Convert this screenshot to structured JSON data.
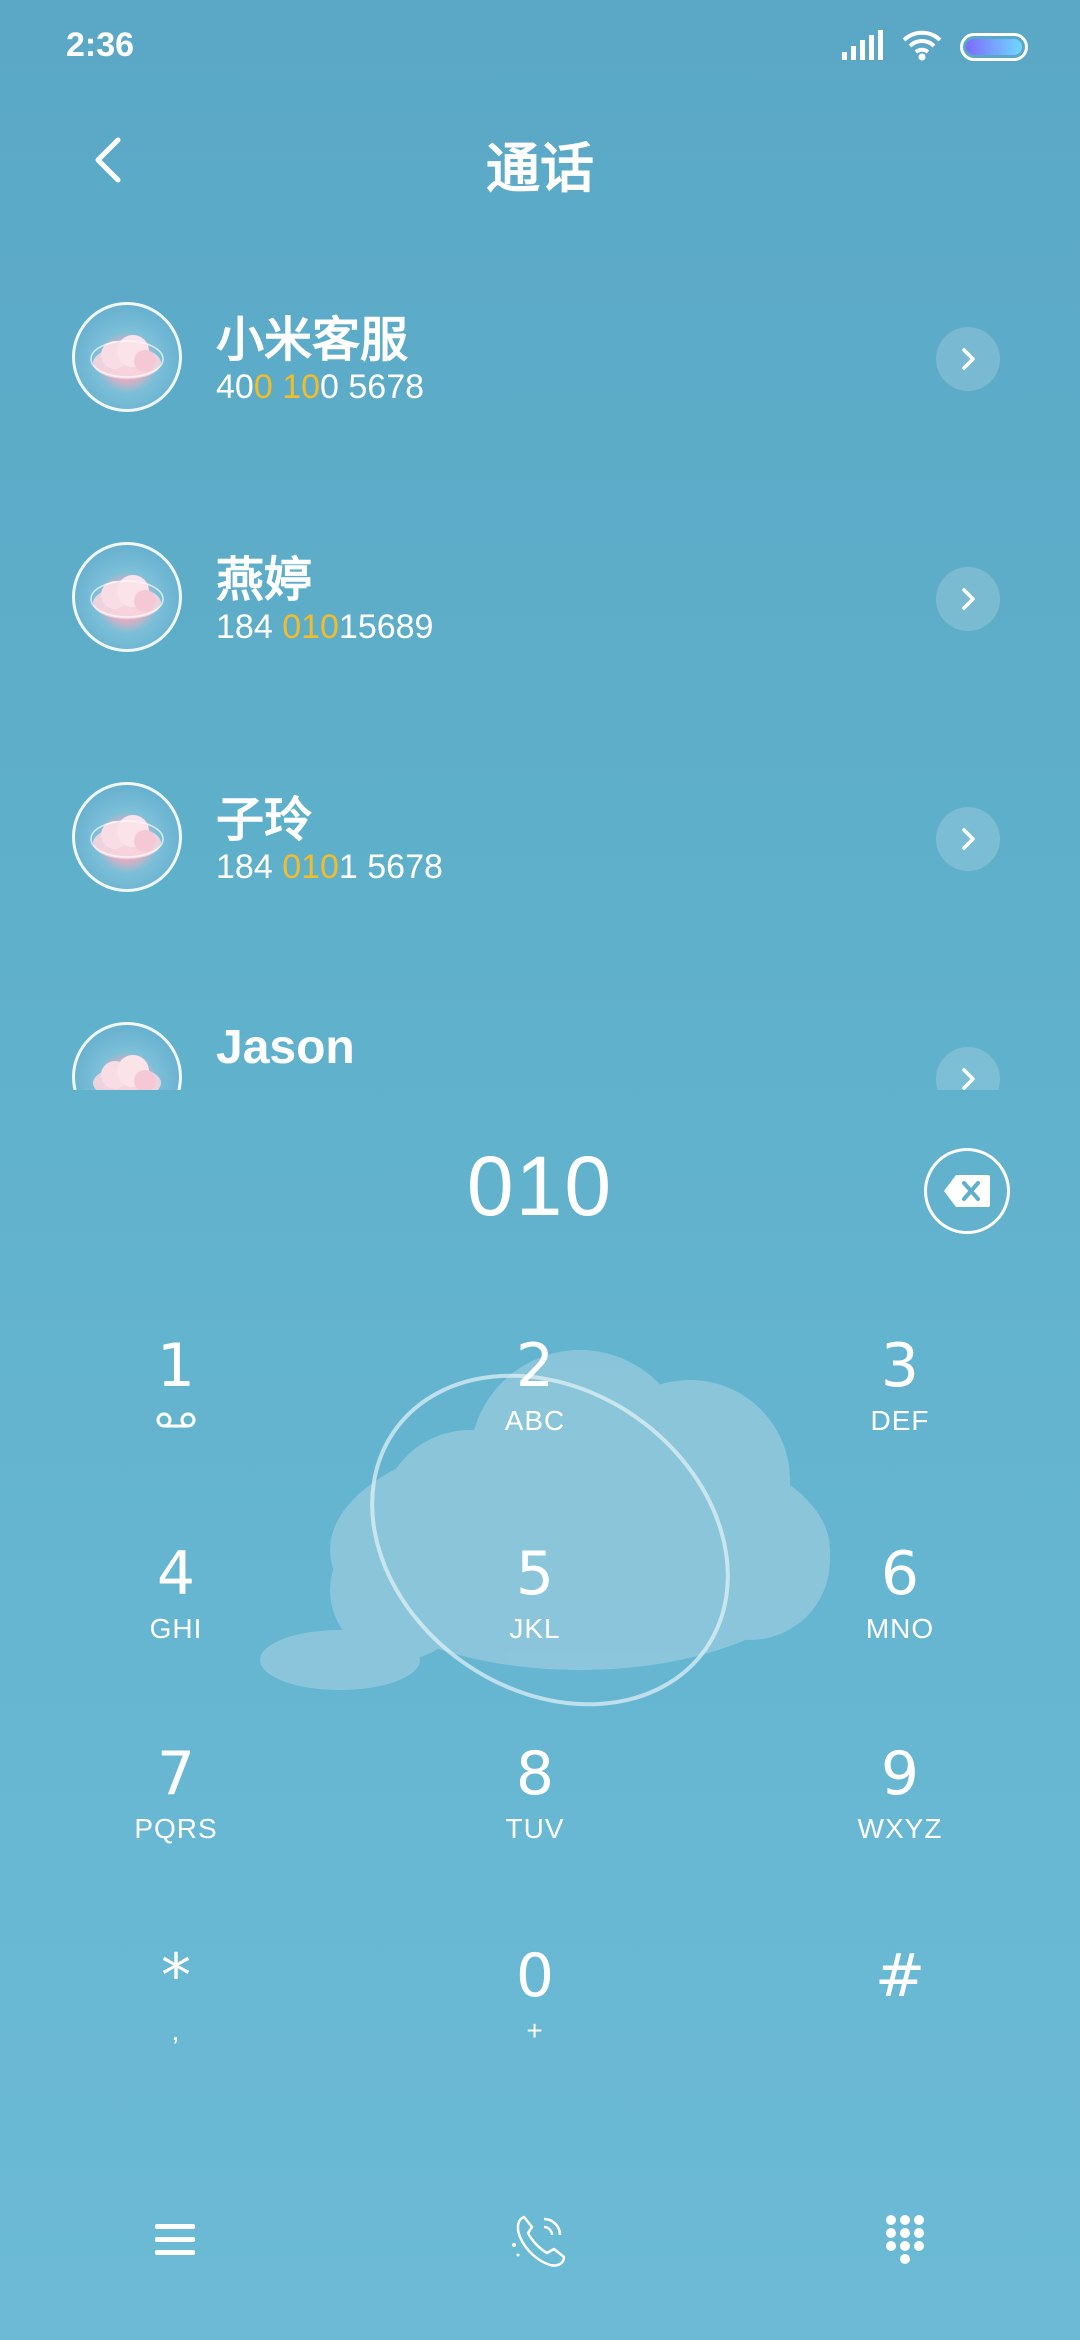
{
  "status_bar": {
    "time": "2:36",
    "battery_icon": "battery-icon",
    "wifi_icon": "wifi-icon",
    "signal_icon": "signal-icon"
  },
  "header": {
    "title": "通话",
    "back_icon": "chevron-left-icon"
  },
  "contacts": [
    {
      "name": "小米客服",
      "number_parts": [
        "40",
        "0",
        " ",
        "10",
        "0 5678"
      ],
      "number_highlight": [
        false,
        true,
        false,
        true,
        false
      ]
    },
    {
      "name": "燕婷",
      "number_parts": [
        "184 ",
        "010",
        "15689"
      ],
      "number_highlight": [
        false,
        true,
        false
      ]
    },
    {
      "name": "子玲",
      "number_parts": [
        "184 ",
        "010",
        "1 5678"
      ],
      "number_highlight": [
        false,
        true,
        false
      ]
    },
    {
      "name": "Jason",
      "number_parts": [],
      "number_highlight": []
    }
  ],
  "dialer": {
    "input": "010",
    "backspace_icon": "backspace-icon"
  },
  "keys": [
    {
      "digit": "1",
      "letters": ""
    },
    {
      "digit": "2",
      "letters": "ABC"
    },
    {
      "digit": "3",
      "letters": "DEF"
    },
    {
      "digit": "4",
      "letters": "GHI"
    },
    {
      "digit": "5",
      "letters": "JKL"
    },
    {
      "digit": "6",
      "letters": "MNO"
    },
    {
      "digit": "7",
      "letters": "PQRS"
    },
    {
      "digit": "8",
      "letters": "TUV"
    },
    {
      "digit": "9",
      "letters": "WXYZ"
    },
    {
      "digit": "*",
      "letters": ","
    },
    {
      "digit": "0",
      "letters": "+"
    },
    {
      "digit": "#",
      "letters": ""
    }
  ],
  "bottom_bar": {
    "menu_icon": "menu-icon",
    "call_icon": "phone-call-icon",
    "keypad_icon": "dialpad-icon"
  },
  "colors": {
    "highlight": "#f2bd2a",
    "background": "#5fb0cb"
  }
}
